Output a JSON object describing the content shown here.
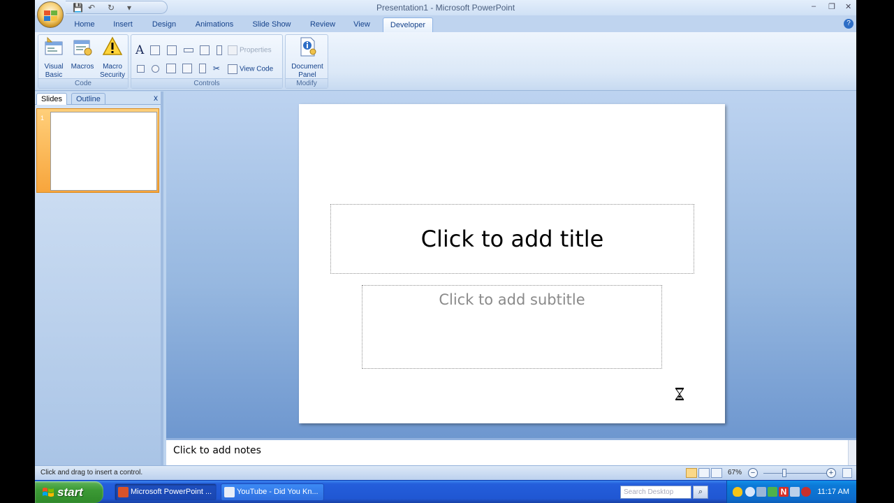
{
  "window": {
    "title": "Presentation1 - Microsoft PowerPoint",
    "controls": {
      "minimize": "‒",
      "restore": "❐",
      "close": "✕"
    }
  },
  "qat": {
    "save": "💾",
    "undo": "↶",
    "redo": "↻",
    "customize": "▾"
  },
  "tabs": [
    {
      "label": "Home"
    },
    {
      "label": "Insert"
    },
    {
      "label": "Design"
    },
    {
      "label": "Animations"
    },
    {
      "label": "Slide Show"
    },
    {
      "label": "Review"
    },
    {
      "label": "View"
    },
    {
      "label": "Developer"
    }
  ],
  "ribbon": {
    "code": {
      "label": "Code",
      "visual_basic": "Visual Basic",
      "macros": "Macros",
      "macro_security": "Macro Security"
    },
    "controls": {
      "label": "Controls",
      "properties": "Properties",
      "view_code": "View Code"
    },
    "modify": {
      "label": "Modify",
      "document_panel": "Document Panel"
    }
  },
  "left_pane": {
    "tabs": [
      "Slides",
      "Outline"
    ],
    "close": "x",
    "thumb_number": "1"
  },
  "slide": {
    "title_placeholder": "Click to add title",
    "subtitle_placeholder": "Click to add subtitle"
  },
  "notes": {
    "placeholder": "Click to add notes"
  },
  "status": {
    "message": "Click and drag to insert a control.",
    "zoom": "67%",
    "zoom_level": 0.67,
    "zoom_out": "−",
    "zoom_in": "+"
  },
  "taskbar": {
    "start": "start",
    "items": [
      {
        "label": "Microsoft PowerPoint ..."
      },
      {
        "label": "YouTube - Did You Kn..."
      }
    ],
    "search_placeholder": "Search Desktop",
    "clock": "11:17 AM"
  },
  "colors": {
    "accent": "#15428b",
    "selected_thumb": "#f7a53c",
    "taskbar": "#245edb",
    "start": "#3c9a35"
  }
}
